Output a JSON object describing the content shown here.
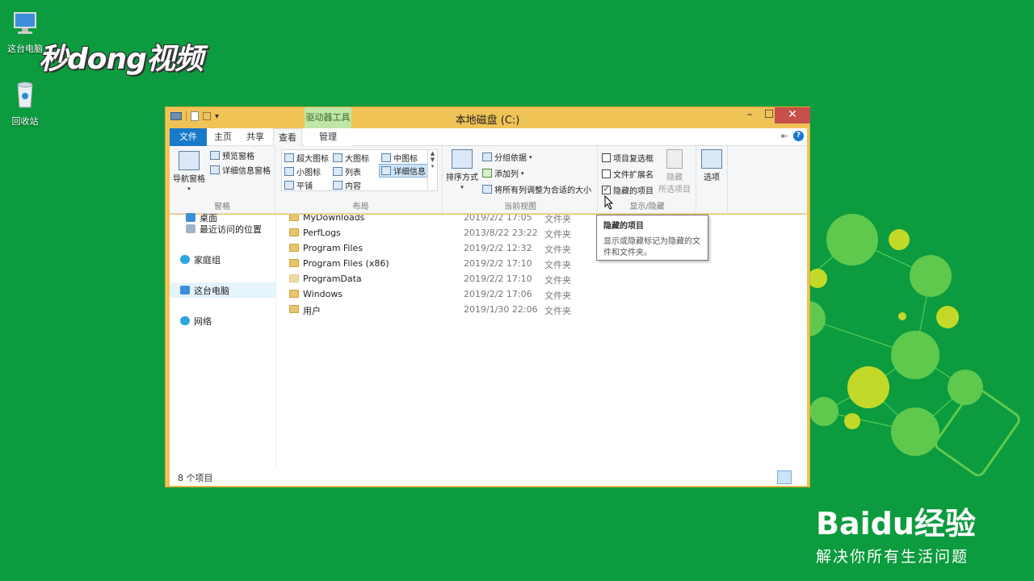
{
  "desktop": {
    "icons": [
      {
        "label": "这台电脑",
        "icon": "computer-icon"
      },
      {
        "label": "回收站",
        "icon": "recycle-bin-icon"
      }
    ],
    "watermark": "秒dong视频",
    "baidu": {
      "brand": "Baidu经验",
      "slogan": "解决你所有生活问题"
    }
  },
  "window": {
    "title": "本地磁盘 (C:)",
    "context_tab": "驱动器工具",
    "tabs": [
      "文件",
      "主页",
      "共享",
      "查看",
      "管理"
    ],
    "active_tab": "查看",
    "ribbon": {
      "panes": {
        "label": "窗格",
        "nav_pane": "导航窗格",
        "preview_pane": "预览窗格",
        "details_pane": "详细信息窗格"
      },
      "layout": {
        "label": "布局",
        "options": [
          "超大图标",
          "大图标",
          "中图标",
          "小图标",
          "列表",
          "详细信息",
          "平铺",
          "内容"
        ],
        "selected": "详细信息"
      },
      "current_view": {
        "label": "当前视图",
        "sort_by": "排序方式",
        "group_by": "分组依据",
        "add_column": "添加列",
        "fit_columns": "将所有列调整为合适的大小"
      },
      "show_hide": {
        "label": "显示/隐藏",
        "item_checkboxes": "项目复选框",
        "file_extensions": "文件扩展名",
        "hidden_items": "隐藏的项目",
        "item_checkboxes_checked": false,
        "file_extensions_checked": false,
        "hidden_items_checked": true,
        "hide_selected_line1": "隐藏",
        "hide_selected_line2": "所选项目"
      },
      "options": {
        "label": "选项"
      }
    },
    "nav": [
      {
        "label": "桌面",
        "icon": "desktop-icon"
      },
      {
        "label": "最近访问的位置",
        "icon": "recent-places-icon"
      },
      {
        "label": "家庭组",
        "icon": "homegroup-icon"
      },
      {
        "label": "这台电脑",
        "icon": "computer-icon"
      },
      {
        "label": "网络",
        "icon": "network-icon"
      }
    ],
    "files": [
      {
        "name": "MyDownloads",
        "date": "2019/2/2 17:05",
        "type": "文件夹"
      },
      {
        "name": "PerfLogs",
        "date": "2013/8/22 23:22",
        "type": "文件夹"
      },
      {
        "name": "Program Files",
        "date": "2019/2/2 12:32",
        "type": "文件夹"
      },
      {
        "name": "Program Files (x86)",
        "date": "2019/2/2 17:10",
        "type": "文件夹"
      },
      {
        "name": "ProgramData",
        "date": "2019/2/2 17:10",
        "type": "文件夹"
      },
      {
        "name": "Windows",
        "date": "2019/2/2 17:06",
        "type": "文件夹"
      },
      {
        "name": "用户",
        "date": "2019/1/30 22:06",
        "type": "文件夹"
      }
    ],
    "status": "8 个项目",
    "tooltip": {
      "title": "隐藏的项目",
      "body": "显示或隐藏标记为隐藏的文件和文件夹。"
    }
  },
  "colors": {
    "desktop": "#0c9b3e",
    "titlebar": "#f0c356",
    "file_tab": "#1979ca",
    "close": "#c7504a"
  }
}
